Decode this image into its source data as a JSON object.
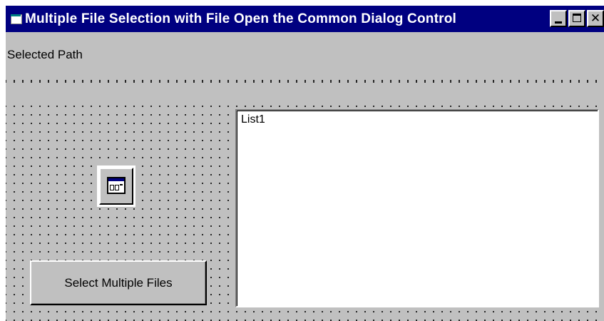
{
  "window": {
    "title": "Multiple File Selection with File Open the Common Dialog Control",
    "app_icon": "form-icon",
    "controls": {
      "minimize_icon": "minimize-icon",
      "maximize_icon": "maximize-icon",
      "close_icon": "close-icon",
      "close_glyph": "✕"
    }
  },
  "form": {
    "path_label": "Selected Path",
    "listbox_text": "List1",
    "common_dialog_icon": "common-dialog-icon",
    "button_label": "Select Multiple Files"
  },
  "colors": {
    "titlebar": "#000080",
    "form_bg": "#c0c0c0",
    "listbox_bg": "#ffffff"
  }
}
